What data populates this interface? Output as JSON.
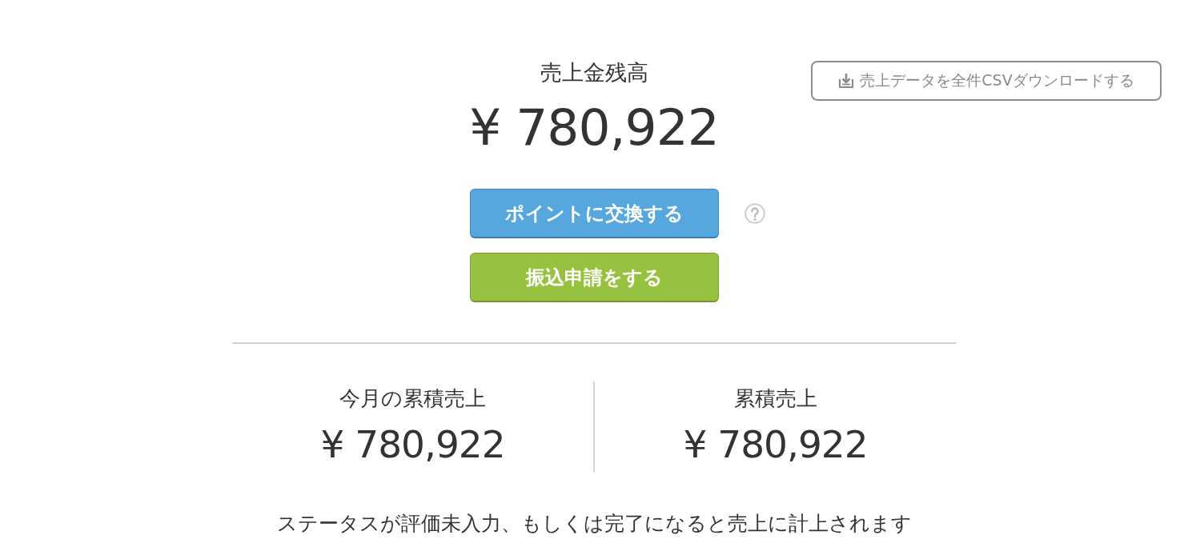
{
  "balance": {
    "label": "売上金残高",
    "amount": "¥ 780,922"
  },
  "download_button": {
    "label": "売上データを全件CSVダウンロードする"
  },
  "actions": [
    {
      "label": "ポイントに交換する",
      "kind": "exchange",
      "help": true
    },
    {
      "label": "振込申請をする",
      "kind": "transfer",
      "help": false
    }
  ],
  "stats": [
    {
      "label": "今月の累積売上",
      "amount": "¥ 780,922"
    },
    {
      "label": "累積売上",
      "amount": "¥ 780,922"
    }
  ],
  "note": "ステータスが評価未入力、もしくは完了になると売上に計上されます"
}
